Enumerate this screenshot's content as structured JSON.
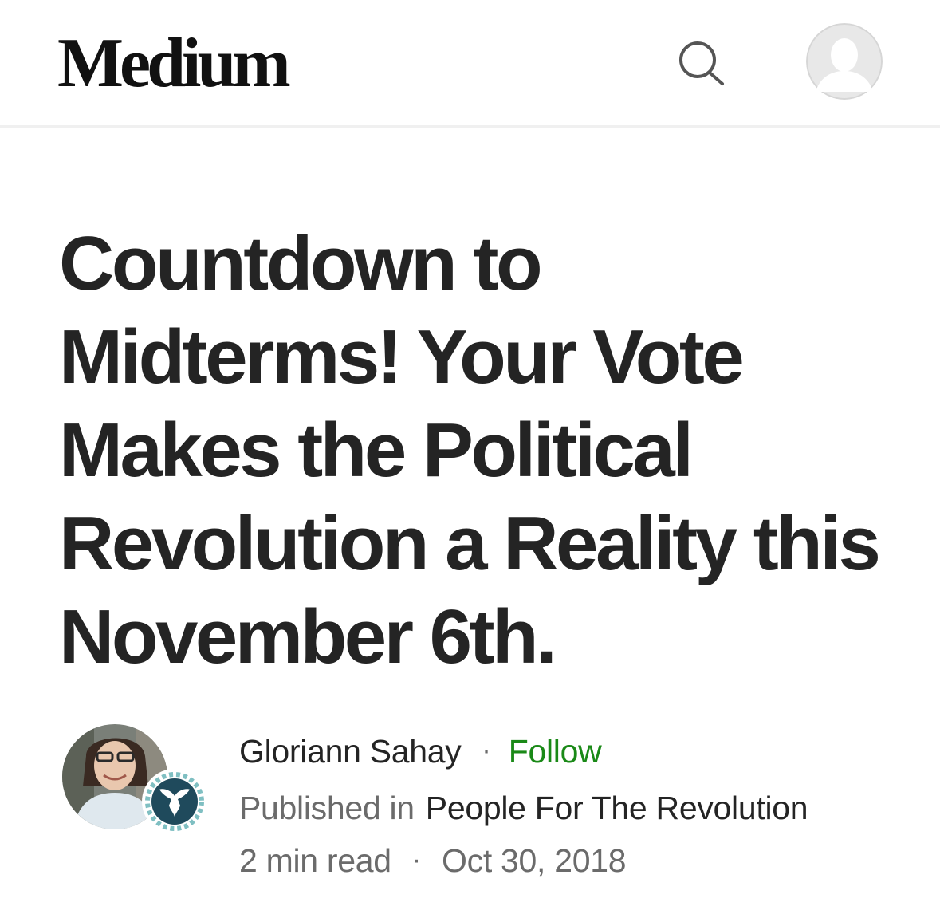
{
  "header": {
    "logo_text": "Medium",
    "search_icon": "search-icon",
    "profile_icon": "user-avatar-icon"
  },
  "article": {
    "title_lines": [
      "Countdown to",
      "Midterms! Your Vote",
      "Makes the Political",
      "Revolution a Reality this",
      "November 6th."
    ]
  },
  "byline": {
    "author_name": "Gloriann Sahay",
    "separator": "·",
    "follow_label": "Follow",
    "published_in_label": "Published in",
    "publication_name": "People For The Revolution",
    "read_time": "2 min read",
    "date": "Oct 30, 2018"
  },
  "colors": {
    "follow": "#1a8917",
    "text": "#242424",
    "muted": "#6b6b6b",
    "publication_badge": "#1f4a5c"
  }
}
